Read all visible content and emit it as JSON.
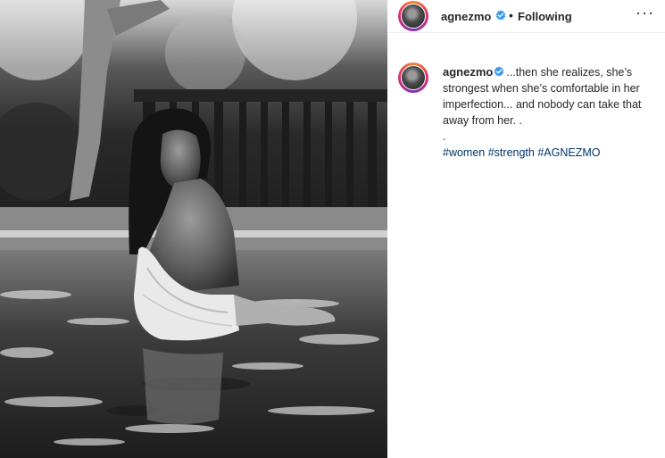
{
  "post": {
    "username": "agnezmo",
    "follow_state": "Following",
    "separator": "•",
    "more_label": "···",
    "caption": "...then she realizes, she’s strongest when she’s comfortable in her imperfection... and nobody can take that away from her. .",
    "caption_dot": ".",
    "hashtags": [
      "#women",
      "#strength",
      "#AGNEZMO"
    ]
  },
  "icons": {
    "verified": "verified-badge-icon",
    "more": "more-options-icon"
  },
  "colors": {
    "verified": "#3897f0",
    "hashtag": "#00376b",
    "text": "#262626",
    "border": "#efefef"
  }
}
